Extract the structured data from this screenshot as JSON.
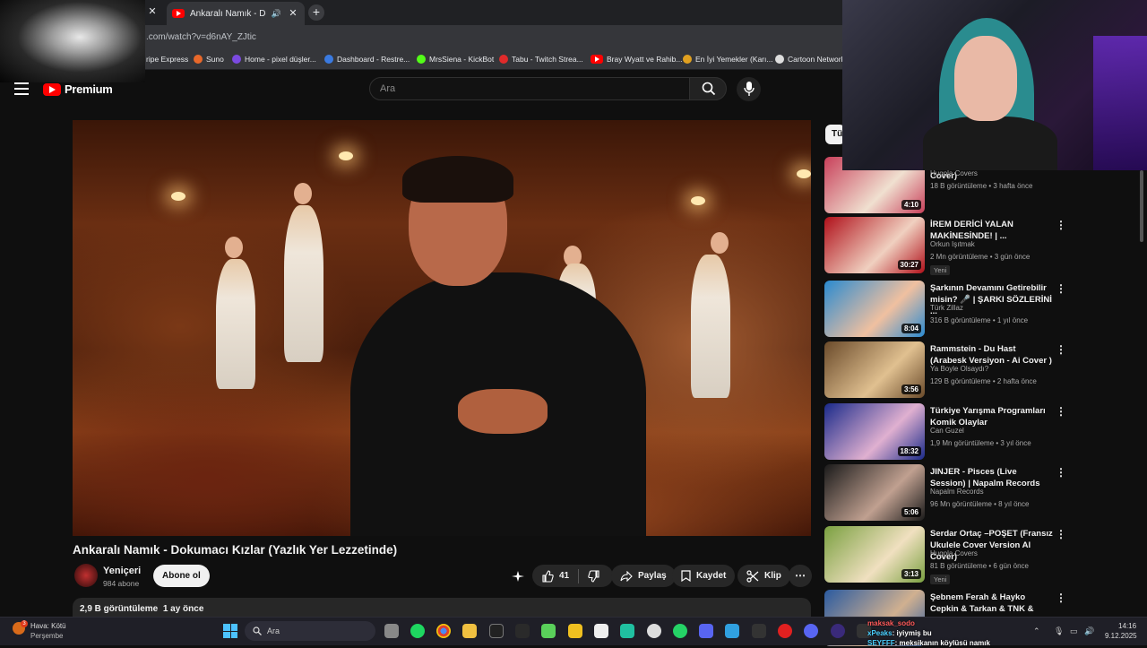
{
  "browser": {
    "active_tab_title": "Ankaralı Namık - Dokumacı",
    "url": ".com/watch?v=d6nAY_ZJtic",
    "bookmarks": [
      "ripe Express",
      "Suno",
      "Home - pixel düşler...",
      "Dashboard - Restre...",
      "MrsSiena - KickBot",
      "Tabu - Twitch Strea...",
      "Bray Wyatt ve Rahib...",
      "En İyi Yemekler (Karı...",
      "Cartoon Network"
    ]
  },
  "youtube": {
    "logo_text": "Premium",
    "search_placeholder": "Ara"
  },
  "video": {
    "title": "Ankaralı Namık - Dokumacı Kızlar (Yazlık Yer Lezzetinde)",
    "channel_name": "Yeniçeri",
    "channel_subs": "984 abone",
    "subscribe_label": "Abone ol",
    "like_count": "41",
    "share_label": "Paylaş",
    "save_label": "Kaydet",
    "clip_label": "Klip",
    "views": "2,9 B görüntüleme",
    "published": "1 ay önce"
  },
  "sidebar": {
    "chip_all": "Tü",
    "items": [
      {
        "title": "Motown Soul Version AI Cover)",
        "channel": "Hugola Covers",
        "meta": "18 B görüntüleme • 3 hafta önce",
        "duration": "4:10",
        "badge": "",
        "color1": "#c8405a",
        "color2": "#f0e0d0"
      },
      {
        "title": "İREM DERİCİ YALAN MAKİNESİNDE! | ...",
        "channel": "Orkun Işıtmak",
        "meta": "2 Mn görüntüleme • 3 gün önce",
        "duration": "30:27",
        "badge": "Yeni",
        "color1": "#b0101a",
        "color2": "#f0d0c0"
      },
      {
        "title": "Şarkının Devamını Getirebilir misin? 🎤 | ŞARKI SÖZLERİNİ ...",
        "channel": "Türk Zillaz",
        "meta": "316 B görüntüleme • 1 yıl önce",
        "duration": "8:04",
        "badge": "",
        "color1": "#2a8ad0",
        "color2": "#f0c0a0"
      },
      {
        "title": "Rammstein - Du Hast (Arabesk Versiyon - Ai Cover )",
        "channel": "Ya Boyle Olsaydı?",
        "meta": "129 B görüntüleme • 2 hafta önce",
        "duration": "3:56",
        "badge": "",
        "color1": "#6a4a2a",
        "color2": "#e0c090"
      },
      {
        "title": "Türkiye Yarışma Programları Komik Olaylar",
        "channel": "Can Guzel",
        "meta": "1,9 Mn görüntüleme • 3 yıl önce",
        "duration": "18:32",
        "badge": "",
        "color1": "#1a2a8a",
        "color2": "#e0b0d0"
      },
      {
        "title": "JINJER - Pisces (Live Session) | Napalm Records",
        "channel": "Napalm Records",
        "meta": "96 Mn görüntüleme • 8 yıl önce",
        "duration": "5:06",
        "badge": "",
        "color1": "#1a1a1a",
        "color2": "#c0a090"
      },
      {
        "title": "Serdar Ortaç –POŞET (Fransız Ukulele Cover Version AI Cover)",
        "channel": "Hugola Covers",
        "meta": "81 B görüntüleme • 6 gün önce",
        "duration": "3:13",
        "badge": "Yeni",
        "color1": "#7aa040",
        "color2": "#f0e0c0"
      },
      {
        "title": "Şebnem Ferah & Hayko Cepkin & Tarkan & TNK & Aylin Aslım ...",
        "channel": "",
        "meta": "",
        "duration": "",
        "badge": "",
        "color1": "#2a5aa0",
        "color2": "#d0b090"
      }
    ]
  },
  "taskbar": {
    "weather_title": "Hava: Kötü",
    "weather_day": "Perşembe",
    "weather_badge": "3",
    "search_label": "Ara",
    "time": "14:16",
    "date": "9.12.2025"
  },
  "chat_overlay": {
    "line1_user": "maksak_sodo",
    "line2_user": "xPeaks",
    "line2_text": ": iyiymiş bu",
    "line3_user": "SEYFFF",
    "line3_text": ": meksikanın köylüsü namık"
  }
}
